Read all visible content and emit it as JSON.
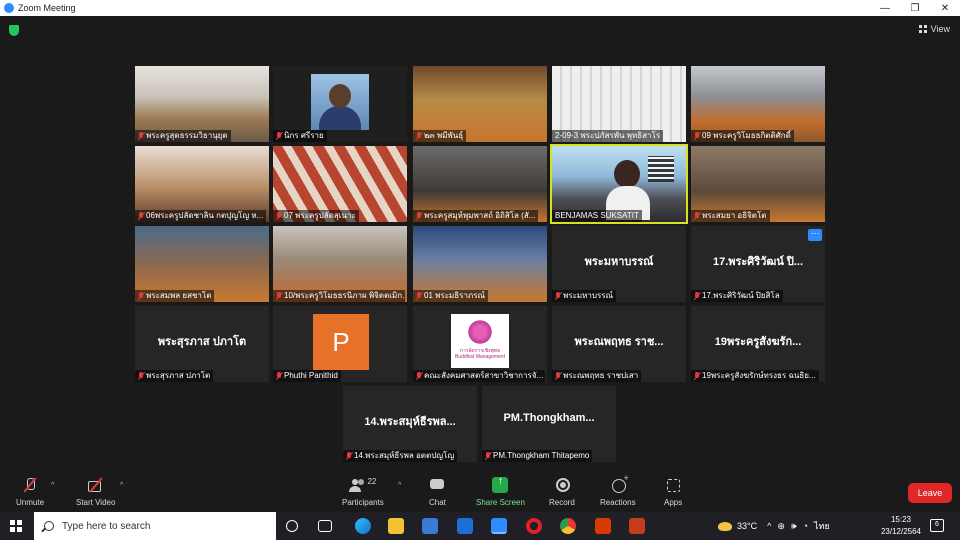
{
  "window": {
    "title": "Zoom Meeting",
    "controls": [
      "—",
      "❐",
      "✕"
    ]
  },
  "view_label": "View",
  "tiles": [
    {
      "label": "พระครูสุตธรรมวิธานุยุต"
    },
    {
      "label": "นิกร ศรีราย"
    },
    {
      "label": "๒๓ พมีพันธุ์"
    },
    {
      "label": "2-09-3 พระปภัสรพัน พุทธิสาโร"
    },
    {
      "label": "09 พระครูวิโมธธกิตติศักดิ์"
    },
    {
      "label": "06พระครูปลัดชาลิน กตปุญโญ ห..."
    },
    {
      "label": "07 พระครูปลัดสุเนาะ"
    },
    {
      "label": "พระครูสมุห์พุมพาสถ์ อิถิสิโล (สั..."
    },
    {
      "label": "BENJAMAS SUKSATIT"
    },
    {
      "label": "พระสมยา อธิจิตโต"
    },
    {
      "label": "พระสมพล ยสชาโต"
    },
    {
      "label": "10/พระครูวิโมธธรนิภาผ พิจิตตเมิก..."
    },
    {
      "label": "01 พระมธิราภรณ์"
    },
    {
      "label": "พระมหาบรรณ์",
      "bigname": "พระมหาบรรณ์"
    },
    {
      "label": "17.พระศิริวัฒน์ ปิยสิโล",
      "bigname": "17.พระศิริวัฒน์ ปิ..."
    },
    {
      "label": "พระสุรภาส ปภาโต",
      "bigname": "พระสุรภาส ปภาโต"
    },
    {
      "label": "Phuthi Panithid",
      "initial": "P"
    },
    {
      "label": "คณะสังคมศาสตร์สาขาวิชาการจั...",
      "logo_text": "การจัดการเชิงพุทธ Buddhist Management"
    },
    {
      "label": "พระณพฤทธ ราชปเสา",
      "bigname": "พระณพฤทธ ราช..."
    },
    {
      "label": "19พระครูสังฆรักษ์ทรงธร ฉนธิย...",
      "bigname": "19พระครูสังฆรัก..."
    },
    {
      "label": "14.พระสมุห์ธีรพล อตตปญโญ",
      "bigname": "14.พระสมุห์ธีรพล..."
    },
    {
      "label": "PM.Thongkham Thitapemo",
      "bigname": "PM.Thongkham..."
    }
  ],
  "toolbar": {
    "unmute": "Unmute",
    "start_video": "Start Video",
    "participants": "Participants",
    "participants_count": "22",
    "chat": "Chat",
    "share_screen": "Share Screen",
    "record": "Record",
    "reactions": "Reactions",
    "apps": "Apps",
    "leave": "Leave"
  },
  "taskbar": {
    "search_placeholder": "Type here to search",
    "temperature": "33°C",
    "language": "ไทย",
    "time": "15:23",
    "date": "23/12/2564",
    "notifications": "6"
  },
  "colors": {
    "zoom_blue": "#2d8cff",
    "share_green": "#23a84a",
    "leave_red": "#e02828",
    "active_border": "#d6e31a"
  }
}
